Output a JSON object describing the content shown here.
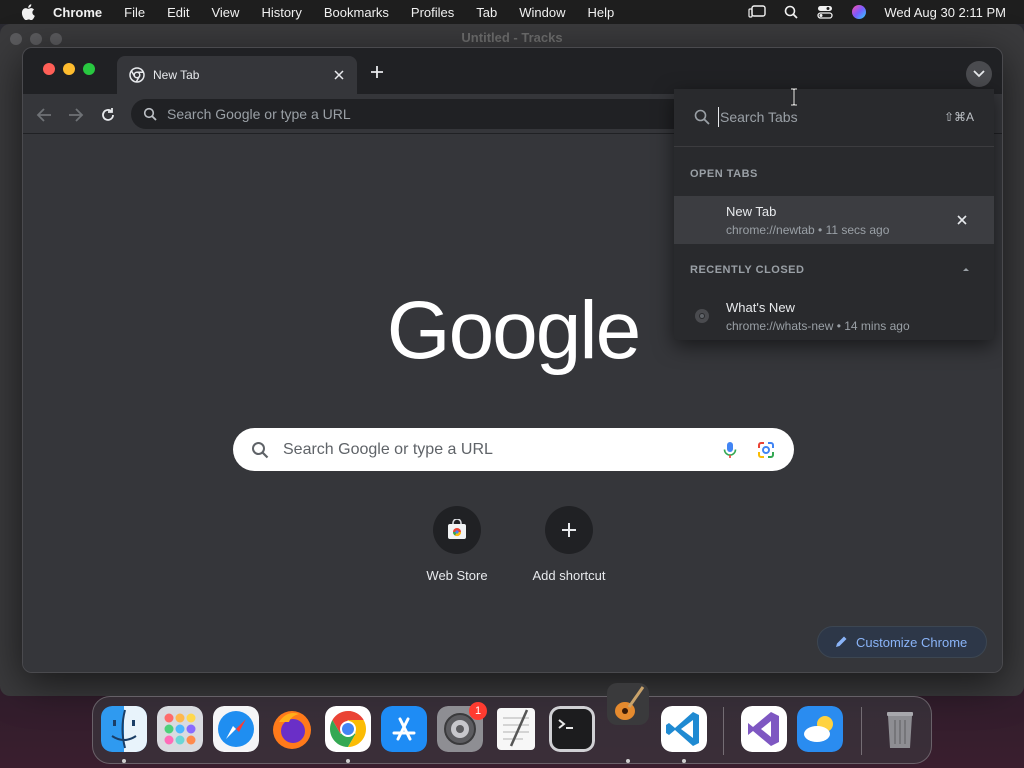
{
  "menubar": {
    "app_name": "Chrome",
    "items": [
      "File",
      "Edit",
      "View",
      "History",
      "Bookmarks",
      "Profiles",
      "Tab",
      "Window",
      "Help"
    ],
    "datetime": "Wed Aug 30  2:11 PM"
  },
  "background_window": {
    "title": "Untitled - Tracks"
  },
  "chrome": {
    "tab": {
      "title": "New Tab"
    },
    "omnibox": {
      "placeholder": "Search Google or type a URL"
    },
    "ntp": {
      "logo": "Google",
      "search_placeholder": "Search Google or type a URL",
      "shortcuts": [
        {
          "label": "Web Store"
        },
        {
          "label": "Add shortcut"
        }
      ],
      "customize_label": "Customize Chrome"
    },
    "tab_search": {
      "placeholder": "Search Tabs",
      "shortcut": "⇧⌘A",
      "open_tabs_header": "OPEN TABS",
      "open_tabs": [
        {
          "title": "New Tab",
          "subtitle": "chrome://newtab • 11 secs ago"
        }
      ],
      "recently_closed_header": "RECENTLY CLOSED",
      "recently_closed": [
        {
          "title": "What's New",
          "subtitle": "chrome://whats-new • 14 mins ago"
        }
      ]
    }
  },
  "dock": {
    "apps": [
      "finder-icon",
      "launchpad-icon",
      "safari-icon",
      "firefox-icon",
      "chrome-icon",
      "app-store-icon",
      "system-settings-icon",
      "textedit-icon",
      "terminal-icon",
      "garageband-icon",
      "vscode-icon",
      "visual-studio-icon",
      "weather-icon",
      "trash-icon"
    ],
    "settings_badge": "1"
  },
  "colors": {
    "accent": "#8ab4f8",
    "window_bg": "#35363a",
    "tabstrip_bg": "#202124"
  }
}
